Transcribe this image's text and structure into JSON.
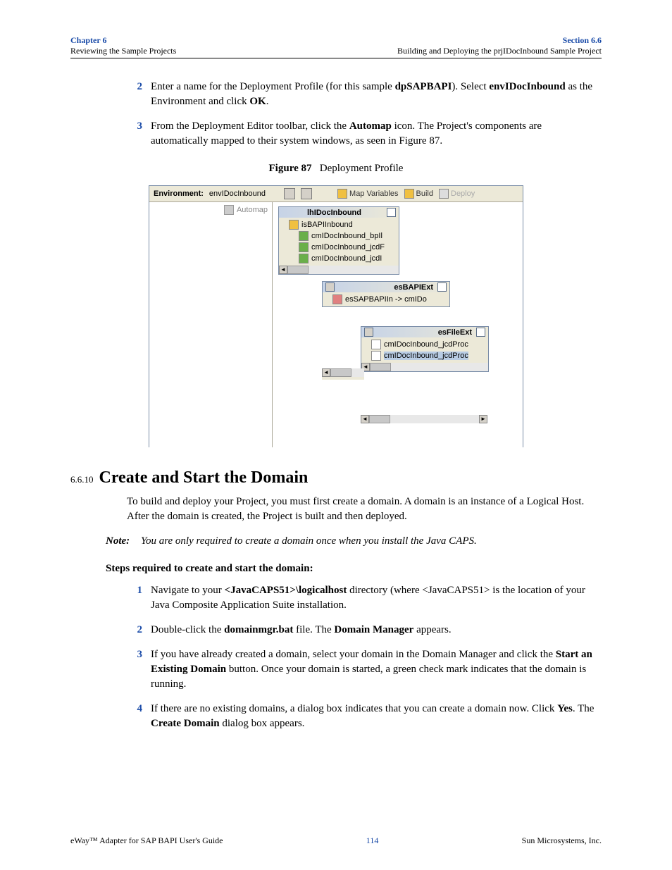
{
  "header": {
    "chapter": "Chapter 6",
    "chapter_sub": "Reviewing the Sample Projects",
    "section": "Section 6.6",
    "section_sub": "Building and Deploying the prjIDocInbound Sample Project"
  },
  "top_steps": [
    {
      "num": "2",
      "parts": [
        "Enter a name for the Deployment Profile (for this sample ",
        "dpSAPBAPI",
        "). Select ",
        "envIDocInbound",
        " as the Environment and click ",
        "OK",
        "."
      ]
    },
    {
      "num": "3",
      "parts": [
        "From the Deployment Editor toolbar, click the ",
        "Automap",
        " icon. The Project's components are automatically mapped to their system windows, as seen in Figure 87."
      ]
    }
  ],
  "figure": {
    "caption_label": "Figure 87",
    "caption_text": "Deployment Profile",
    "env_label": "Environment:",
    "env_value": "envIDocInbound",
    "tb_map": "Map Variables",
    "tb_build": "Build",
    "tb_deploy": "Deploy",
    "automap": "Automap",
    "win1_title": "lhIDocInbound",
    "win1_rows": [
      "isBAPIInbound",
      "cmIDocInbound_bpIl",
      "cmIDocInbound_jcdF",
      "cmIDocInbound_jcdI"
    ],
    "win2_title": "esBAPIExt",
    "win2_row": "esSAPBAPIIn -> cmIDo",
    "win3_title": "esFileExt",
    "win3_rows": [
      "cmIDocInbound_jcdProc",
      "cmIDocInbound_jcdProc"
    ]
  },
  "section_head": {
    "num": "6.6.10",
    "title": "Create and Start the Domain"
  },
  "para1": "To build and deploy your Project, you must first create a domain. A domain is an instance of a Logical Host. After the domain is created, the Project is built and then deployed.",
  "note_label": "Note:",
  "note_text": "You are only required to create a domain once when you install the Java CAPS.",
  "steps_head": "Steps required to create and start the domain:",
  "bottom_steps": [
    {
      "num": "1",
      "parts": [
        "Navigate to your ",
        "<JavaCAPS51>\\logicalhost",
        " directory (where <JavaCAPS51> is the location of your Java Composite Application Suite installation."
      ]
    },
    {
      "num": "2",
      "parts": [
        "Double-click the ",
        "domainmgr.bat",
        " file. The ",
        "Domain Manager",
        " appears."
      ]
    },
    {
      "num": "3",
      "parts": [
        "If you have already created a domain, select your domain in the Domain Manager and click the ",
        "Start an Existing Domain",
        " button. Once your domain is started, a green check mark indicates that the domain is running."
      ]
    },
    {
      "num": "4",
      "parts": [
        "If there are no existing domains, a dialog box indicates that you can create a domain now. Click ",
        "Yes",
        ". The ",
        "Create Domain",
        " dialog box appears."
      ]
    }
  ],
  "footer": {
    "left": "eWay™ Adapter for SAP BAPI User's Guide",
    "page": "114",
    "right": "Sun Microsystems, Inc."
  }
}
